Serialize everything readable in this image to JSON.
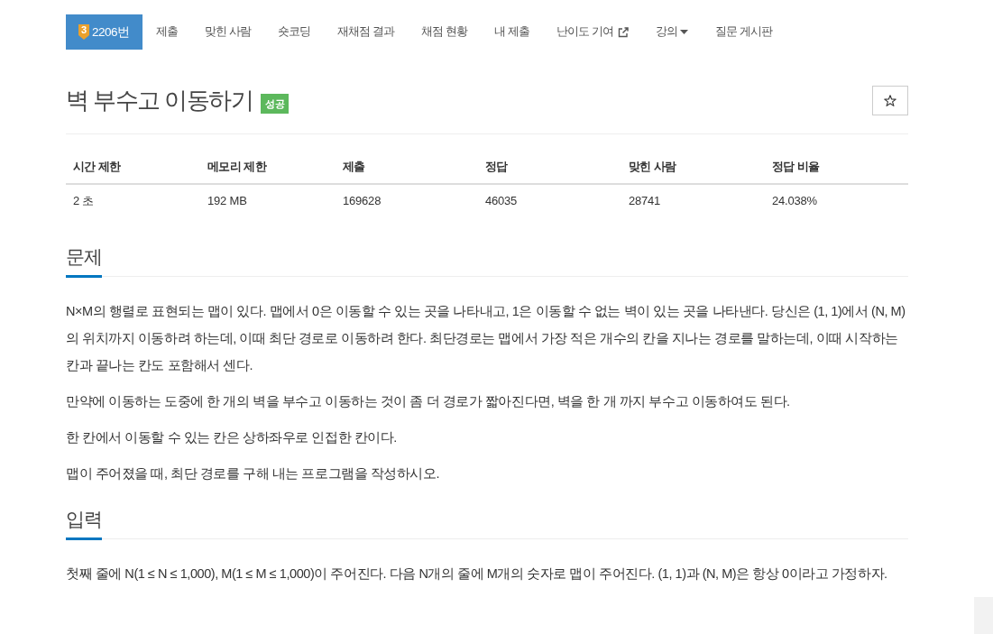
{
  "nav": {
    "items": [
      {
        "kind": "problem",
        "tier": "3",
        "label": "2206번",
        "selected": true
      },
      {
        "kind": "link",
        "label": "제출",
        "selected": false
      },
      {
        "kind": "link",
        "label": "맞힌 사람",
        "selected": false
      },
      {
        "kind": "link",
        "label": "숏코딩",
        "selected": false
      },
      {
        "kind": "link",
        "label": "재채점 결과",
        "selected": false
      },
      {
        "kind": "link",
        "label": "채점 현황",
        "selected": false
      },
      {
        "kind": "link",
        "label": "내 제출",
        "selected": false
      },
      {
        "kind": "external",
        "label": "난이도 기여",
        "selected": false
      },
      {
        "kind": "dropdown",
        "label": "강의",
        "selected": false
      },
      {
        "kind": "link",
        "label": "질문 게시판",
        "selected": false
      }
    ]
  },
  "problem": {
    "title": "벽 부수고 이동하기",
    "result_label": "성공",
    "favorite": {
      "on": false
    }
  },
  "info_table": {
    "columns": [
      "시간 제한",
      "메모리 제한",
      "제출",
      "정답",
      "맞힌 사람",
      "정답 비율"
    ],
    "rows": [
      [
        "2 초",
        "192 MB",
        "169628",
        "46035",
        "28741",
        "24.038%"
      ]
    ]
  },
  "sections": [
    {
      "heading": "문제",
      "paragraphs": [
        "N×M의 행렬로 표현되는 맵이 있다. 맵에서 0은 이동할 수 있는 곳을 나타내고, 1은 이동할 수 없는 벽이 있는 곳을 나타낸다. 당신은 (1, 1)에서 (N, M)의 위치까지 이동하려 하는데, 이때 최단 경로로 이동하려 한다. 최단경로는 맵에서 가장 적은 개수의 칸을 지나는 경로를 말하는데, 이때 시작하는 칸과 끝나는 칸도 포함해서 센다.",
        "만약에 이동하는 도중에 한 개의 벽을 부수고 이동하는 것이 좀 더 경로가 짧아진다면, 벽을 한 개 까지 부수고 이동하여도 된다.",
        "한 칸에서 이동할 수 있는 칸은 상하좌우로 인접한 칸이다.",
        "맵이 주어졌을 때, 최단 경로를 구해 내는 프로그램을 작성하시오."
      ]
    },
    {
      "heading": "입력",
      "paragraphs": [
        "첫째 줄에 N(1 ≤ N ≤ 1,000), M(1 ≤ M ≤ 1,000)이 주어진다. 다음 N개의 줄에 M개의 숫자로 맵이 주어진다. (1, 1)과 (N, M)은 항상 0이라고 가정하자."
      ]
    }
  ]
}
